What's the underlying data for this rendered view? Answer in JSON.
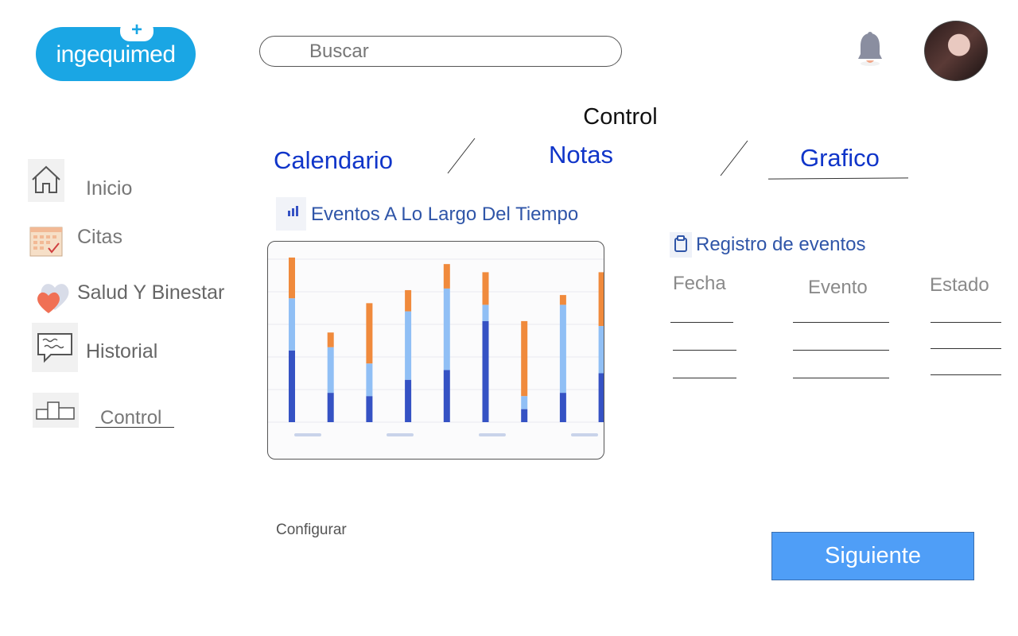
{
  "header": {
    "logo_text": "ingequimed",
    "logo_badge": "+",
    "search_placeholder": "Buscar"
  },
  "page": {
    "title": "Control",
    "tabs": [
      {
        "label": "Calendario"
      },
      {
        "label": "Notas"
      },
      {
        "label": "Grafico"
      }
    ]
  },
  "sidebar": {
    "items": [
      {
        "label": "Inicio",
        "icon": "home-icon"
      },
      {
        "label": "Citas",
        "icon": "calendar-icon"
      },
      {
        "label": "Salud Y Binestar",
        "icon": "heart-icon"
      },
      {
        "label": "Historial",
        "icon": "chat-icon"
      },
      {
        "label": "Control",
        "icon": "podium-icon"
      }
    ]
  },
  "chart_panel": {
    "title": "Eventos A Lo Largo Del Tiempo"
  },
  "chart_data": {
    "type": "bar",
    "stacked": true,
    "ylim": [
      0,
      100
    ],
    "grid": true,
    "x_tick_labels_illegible": true,
    "categories": [
      "1",
      "2",
      "3",
      "4",
      "5",
      "6",
      "7",
      "8",
      "9"
    ],
    "series": [
      {
        "color": "#3552c4",
        "values": [
          44,
          18,
          16,
          26,
          32,
          62,
          8,
          18,
          30
        ]
      },
      {
        "color": "#90bff5",
        "values": [
          32,
          28,
          20,
          42,
          50,
          10,
          8,
          54,
          29
        ]
      },
      {
        "color": "#f08a3c",
        "values": [
          25,
          9,
          37,
          13,
          15,
          20,
          46,
          6,
          33
        ]
      }
    ]
  },
  "registro": {
    "title": "Registro de eventos",
    "columns": [
      "Fecha",
      "Evento",
      "Estado"
    ]
  },
  "footer": {
    "config_label": "Configurar",
    "next_label": "Siguiente"
  },
  "colors": {
    "brand": "#1aa6e4",
    "tab_text": "#1035c9",
    "section_text": "#2f55a8",
    "button": "#4f9ef7"
  }
}
